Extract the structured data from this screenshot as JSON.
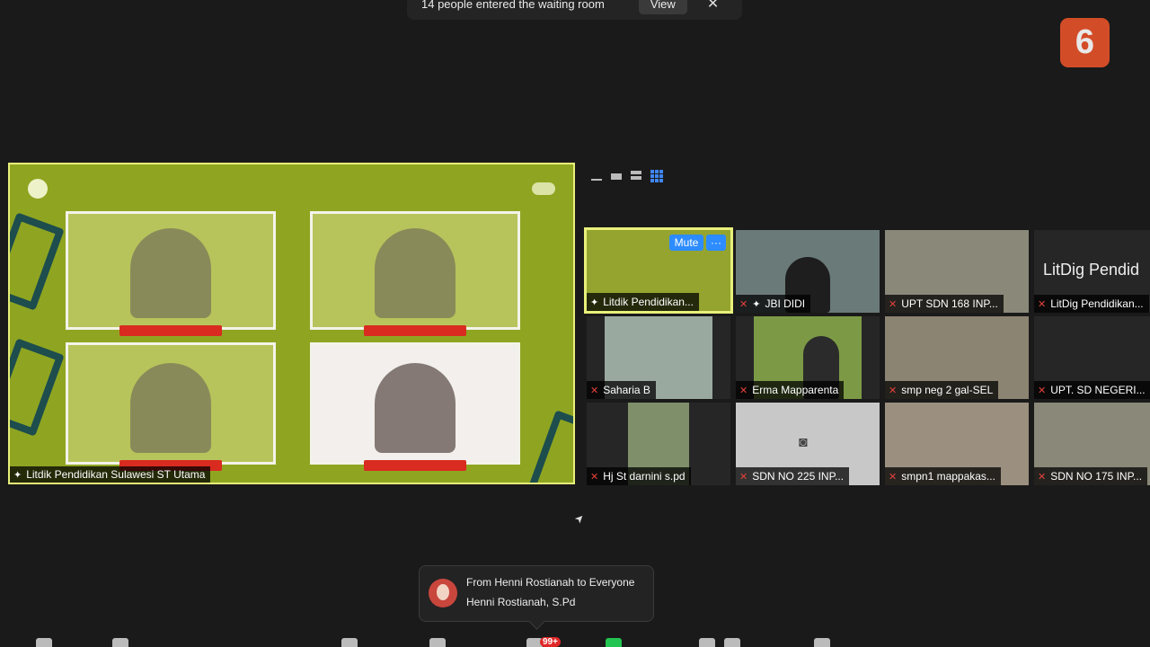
{
  "notification": {
    "text": "14 people entered the waiting room",
    "view_label": "View",
    "close_glyph": "✕"
  },
  "watermark": {
    "logo": "6"
  },
  "main_video": {
    "name": "Litdik Pendidikan Sulawesi ST Utama",
    "icon": "pin-icon"
  },
  "gallery": {
    "tiles": [
      {
        "name": "Litdik Pendidikan...",
        "mic": "pin"
      },
      {
        "name": "JBI DIDI",
        "mic": "pin"
      },
      {
        "name": "UPT SDN 168 INP...",
        "mic": "muted"
      },
      {
        "name": "LitDig Pendidikan...",
        "mic": "muted",
        "big_text": "LitDig Pendid"
      },
      {
        "name": "Saharia B",
        "mic": "muted"
      },
      {
        "name": "Erma Mapparenta",
        "mic": "muted"
      },
      {
        "name": "smp neg  2 gal-SEL",
        "mic": "muted"
      },
      {
        "name": "UPT. SD NEGERI...",
        "mic": "muted"
      },
      {
        "name": "Hj St darnini s.pd",
        "mic": "muted"
      },
      {
        "name": "SDN NO 225 INP...",
        "mic": "muted"
      },
      {
        "name": "smpn1 mappakas...",
        "mic": "muted"
      },
      {
        "name": "SDN NO 175 INP...",
        "mic": "muted"
      }
    ],
    "mute_label": "Mute",
    "more_label": "···"
  },
  "chat": {
    "from": "From Henni Rostianah to Everyone",
    "message": "Henni Rostianah, S.Pd"
  },
  "toolbar": {
    "badge": "99+"
  },
  "colors": {
    "accent": "#2d8cff",
    "active_border": "#e8f07a",
    "muted": "#e5413b"
  }
}
